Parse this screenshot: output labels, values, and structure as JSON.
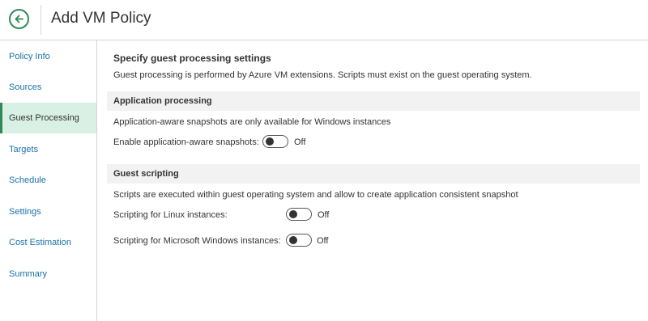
{
  "header": {
    "title": "Add VM Policy",
    "back_icon": "arrow-left-icon"
  },
  "sidebar": {
    "items": [
      {
        "label": "Policy Info"
      },
      {
        "label": "Sources"
      },
      {
        "label": "Guest Processing",
        "active": true
      },
      {
        "label": "Targets"
      },
      {
        "label": "Schedule"
      },
      {
        "label": "Settings"
      },
      {
        "label": "Cost Estimation"
      },
      {
        "label": "Summary"
      }
    ]
  },
  "main": {
    "heading": "Specify guest processing settings",
    "description": "Guest processing is performed by Azure VM extensions. Scripts must exist on the guest operating system.",
    "app_processing": {
      "title": "Application processing",
      "note": "Application-aware snapshots are only available for Windows instances",
      "toggle_label": "Enable application-aware snapshots:",
      "toggle_state": "Off"
    },
    "guest_scripting": {
      "title": "Guest scripting",
      "note": "Scripts are executed within guest operating system and allow to create application consistent snapshot",
      "linux_label": "Scripting for Linux instances:",
      "linux_state": "Off",
      "windows_label": "Scripting for Microsoft Windows instances:",
      "windows_state": "Off"
    }
  },
  "colors": {
    "accent": "#2e8b57",
    "active_bg": "#d9f0e4",
    "link": "#1a73a8"
  }
}
